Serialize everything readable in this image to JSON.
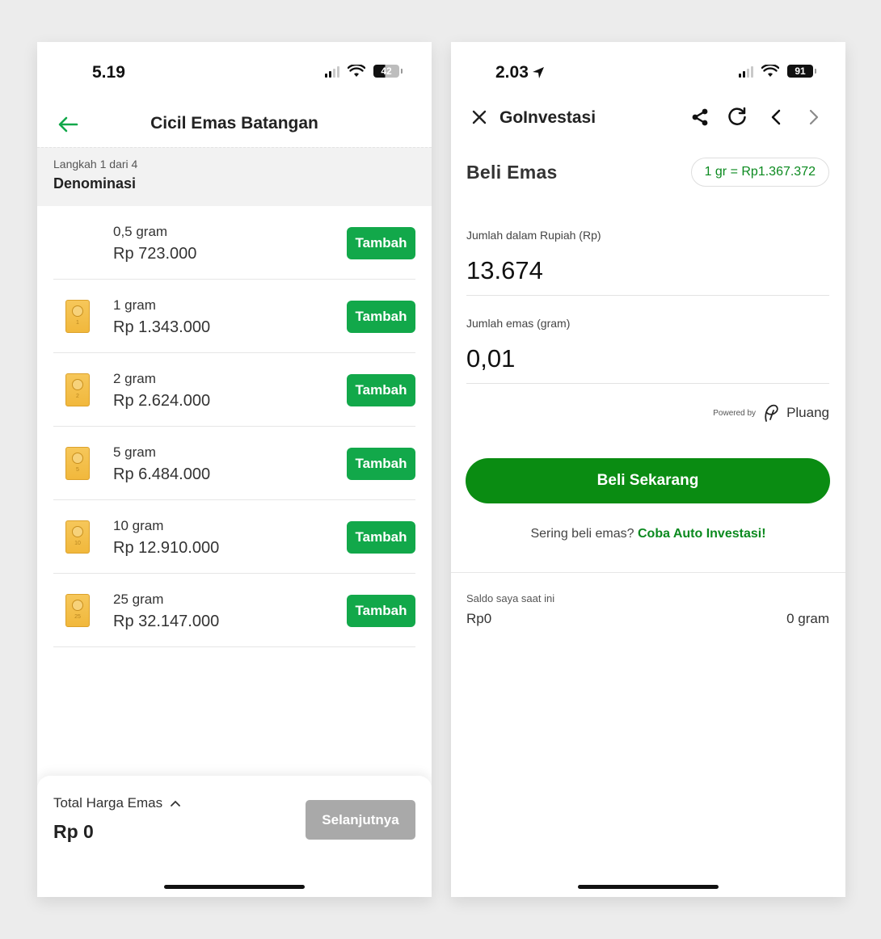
{
  "left": {
    "status": {
      "time": "5.19",
      "battery": "42"
    },
    "header": {
      "title": "Cicil Emas Batangan"
    },
    "step": {
      "label": "Langkah 1 dari 4",
      "title": "Denominasi"
    },
    "items": [
      {
        "weight": "0,5 gram",
        "price": "Rp 723.000",
        "icon_num": "",
        "button": "Tambah"
      },
      {
        "weight": "1 gram",
        "price": "Rp 1.343.000",
        "icon_num": "1",
        "button": "Tambah"
      },
      {
        "weight": "2 gram",
        "price": "Rp 2.624.000",
        "icon_num": "2",
        "button": "Tambah"
      },
      {
        "weight": "5 gram",
        "price": "Rp 6.484.000",
        "icon_num": "5",
        "button": "Tambah"
      },
      {
        "weight": "10 gram",
        "price": "Rp 12.910.000",
        "icon_num": "10",
        "button": "Tambah"
      },
      {
        "weight": "25 gram",
        "price": "Rp 32.147.000",
        "icon_num": "25",
        "button": "Tambah"
      }
    ],
    "footer": {
      "total_label": "Total Harga Emas",
      "total_value": "Rp 0",
      "next_label": "Selanjutnya"
    }
  },
  "right": {
    "status": {
      "time": "2.03",
      "battery": "91"
    },
    "header": {
      "title": "GoInvestasi"
    },
    "beli_title": "Beli Emas",
    "rate": "1 gr = Rp1.367.372",
    "rupiah_label": "Jumlah dalam Rupiah (Rp)",
    "rupiah_value": "13.674",
    "gram_label": "Jumlah emas (gram)",
    "gram_value": "0,01",
    "powered_by": "Powered by",
    "partner": "Pluang",
    "buy_label": "Beli Sekarang",
    "auto_question": "Sering beli emas? ",
    "auto_link": "Coba Auto Investasi!",
    "saldo_label": "Saldo saya saat ini",
    "saldo_rp": "Rp0",
    "saldo_gram": "0 gram"
  },
  "colors": {
    "primary_green": "#12a84a",
    "buy_green": "#0a8c12",
    "gold": "#f3bd45",
    "disabled_gray": "#a9a9a9"
  }
}
